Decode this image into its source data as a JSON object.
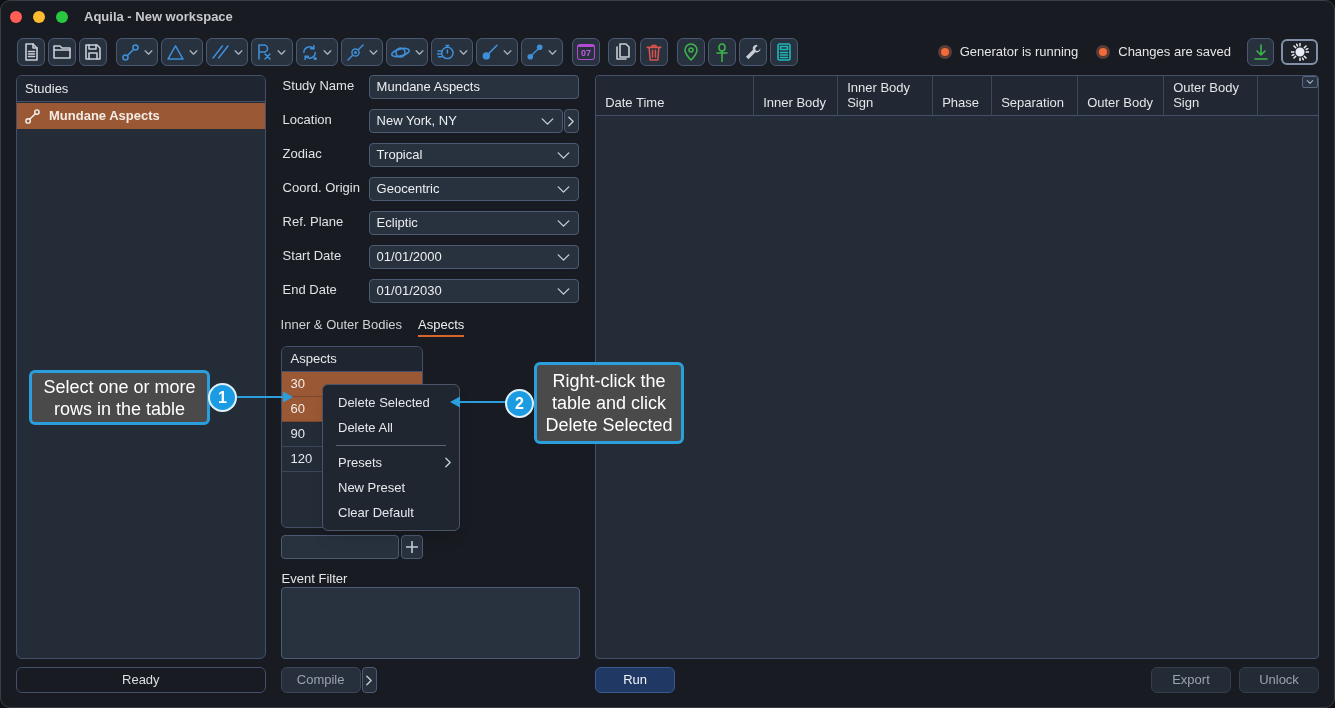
{
  "window": {
    "title": "Aquila - New workspace"
  },
  "toolbar": {
    "calendar_day": "07"
  },
  "status_indicators": [
    {
      "label": "Generator is running",
      "on": true
    },
    {
      "label": "Changes are saved",
      "on": true
    }
  ],
  "studies": {
    "title": "Studies",
    "items": [
      {
        "label": "Mundane Aspects",
        "selected": true
      }
    ]
  },
  "form": {
    "fields": [
      {
        "label": "Study Name",
        "value": "Mundane Aspects",
        "kind": "text"
      },
      {
        "label": "Location",
        "value": "New York, NY",
        "kind": "dropdown_more"
      },
      {
        "label": "Zodiac",
        "value": "Tropical",
        "kind": "dropdown"
      },
      {
        "label": "Coord. Origin",
        "value": "Geocentric",
        "kind": "dropdown"
      },
      {
        "label": "Ref. Plane",
        "value": "Ecliptic",
        "kind": "dropdown"
      },
      {
        "label": "Start Date",
        "value": "01/01/2000",
        "kind": "dropdown"
      },
      {
        "label": "End Date",
        "value": "01/01/2030",
        "kind": "dropdown"
      }
    ]
  },
  "tabs": [
    {
      "label": "Inner & Outer Bodies",
      "selected": false
    },
    {
      "label": "Aspects",
      "selected": true
    }
  ],
  "aspects_table": {
    "header": "Aspects",
    "rows": [
      {
        "value": "30",
        "selected": true
      },
      {
        "value": "60",
        "selected": true
      },
      {
        "value": "90",
        "selected": false
      },
      {
        "value": "120",
        "selected": false
      }
    ]
  },
  "context_menu": {
    "items": [
      {
        "kind": "item",
        "label": "Delete Selected"
      },
      {
        "kind": "item",
        "label": "Delete All"
      },
      {
        "kind": "separator"
      },
      {
        "kind": "submenu",
        "label": "Presets"
      },
      {
        "kind": "item",
        "label": "New Preset"
      },
      {
        "kind": "item",
        "label": "Clear Default"
      }
    ]
  },
  "event_filter": {
    "label": "Event Filter"
  },
  "results_table": {
    "columns": [
      "Date Time",
      "Inner Body",
      "Inner Body Sign",
      "Phase",
      "Separation",
      "Outer Body",
      "Outer Body Sign"
    ]
  },
  "buttons": {
    "status": {
      "label": "Ready"
    },
    "compile": {
      "label": "Compile",
      "disabled": true
    },
    "run": {
      "label": "Run"
    },
    "export": {
      "label": "Export",
      "disabled": true
    },
    "unlock": {
      "label": "Unlock",
      "disabled": true
    }
  },
  "callouts": [
    {
      "number": "1",
      "text": "Select one or more rows in the table"
    },
    {
      "number": "2",
      "text": "Right-click the table and click Delete Selected"
    }
  ]
}
